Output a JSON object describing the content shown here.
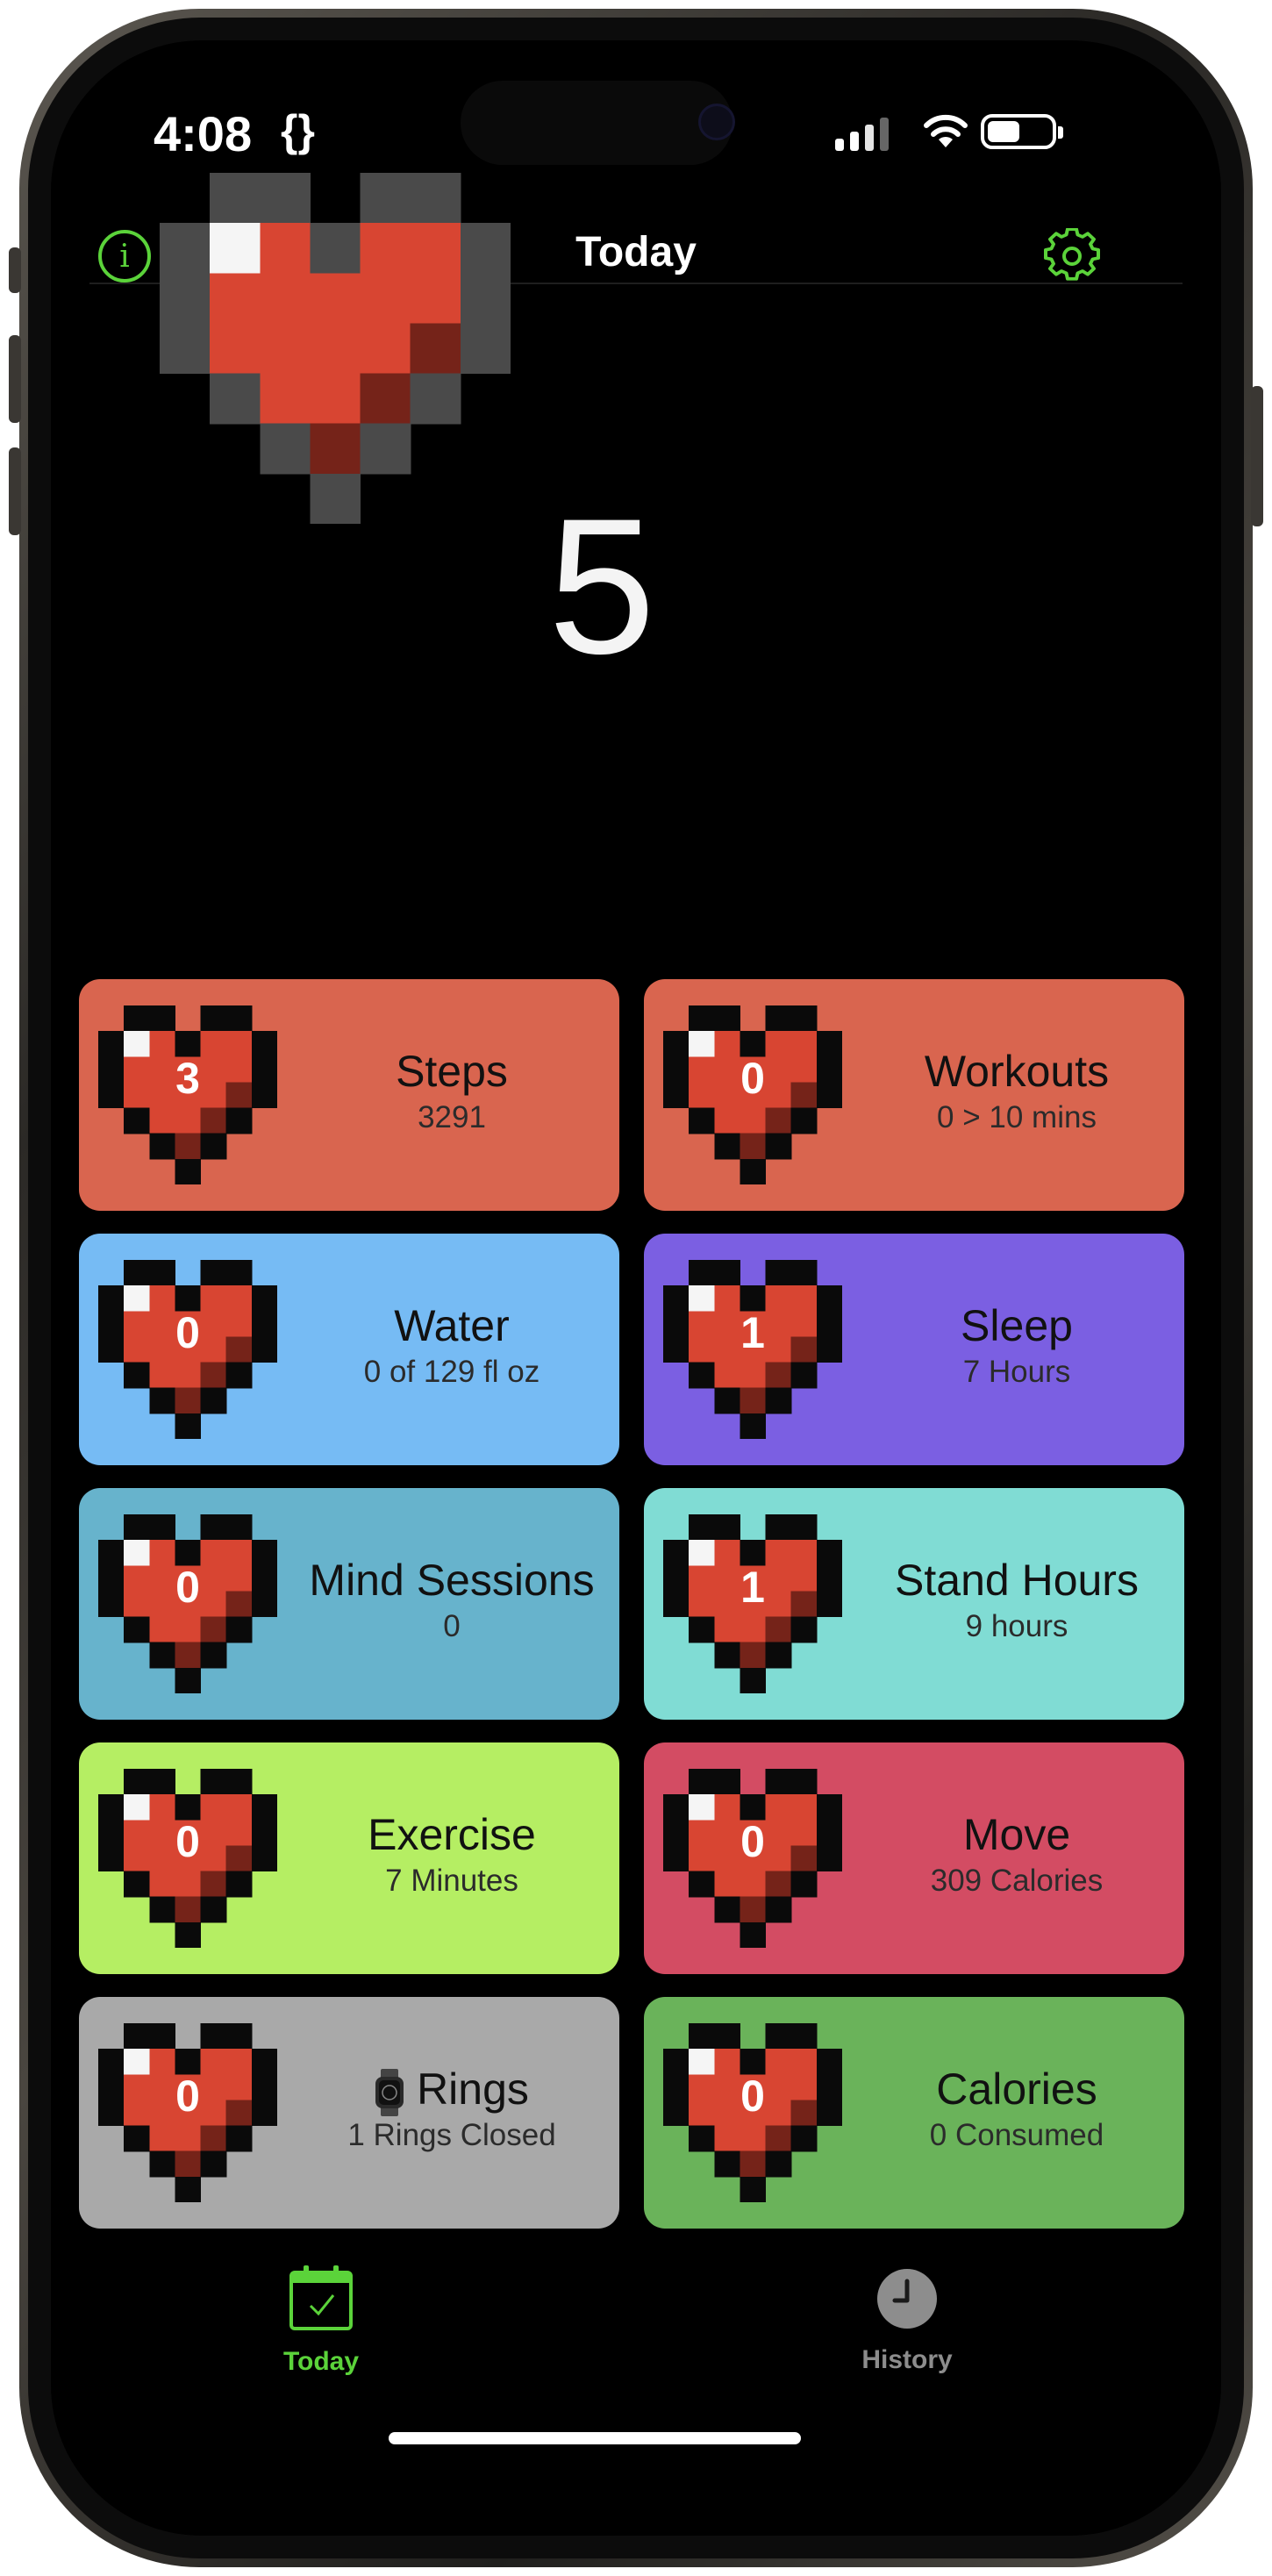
{
  "status_bar": {
    "time": "4:08",
    "extra_symbol": "{}"
  },
  "nav": {
    "title": "Today",
    "info_icon": "info-icon",
    "settings_icon": "gear-icon"
  },
  "overall": {
    "score": "5"
  },
  "cards": [
    {
      "id": "steps",
      "label": "Steps",
      "sub": "3291",
      "score": "3",
      "color": "#d9654f"
    },
    {
      "id": "workouts",
      "label": "Workouts",
      "sub": "0 > 10 mins",
      "score": "0",
      "color": "#d9654f"
    },
    {
      "id": "water",
      "label": "Water",
      "sub": "0 of 129 fl oz",
      "score": "0",
      "color": "#76bbf4"
    },
    {
      "id": "sleep",
      "label": "Sleep",
      "sub": "7 Hours",
      "score": "1",
      "color": "#7b5fe2"
    },
    {
      "id": "mind",
      "label": "Mind Sessions",
      "sub": "0",
      "score": "0",
      "color": "#67b3cc"
    },
    {
      "id": "stand",
      "label": "Stand Hours",
      "sub": "9 hours",
      "score": "1",
      "color": "#80dcd4"
    },
    {
      "id": "exercise",
      "label": "Exercise",
      "sub": "7 Minutes",
      "score": "0",
      "color": "#b5ee63"
    },
    {
      "id": "move",
      "label": "Move",
      "sub": "309 Calories",
      "score": "0",
      "color": "#d34c63"
    },
    {
      "id": "rings",
      "label": "Rings",
      "sub": "1 Rings Closed",
      "score": "0",
      "color": "#a9a9a9",
      "icon": "watch-icon"
    },
    {
      "id": "calories",
      "label": "Calories",
      "sub": "0 Consumed",
      "score": "0",
      "color": "#6ab35a"
    }
  ],
  "tabs": [
    {
      "label": "Today",
      "icon": "calendar-check-icon",
      "active": true
    },
    {
      "label": "History",
      "icon": "clock-icon",
      "active": false
    }
  ],
  "colors": {
    "accent": "#5bd33a",
    "heart_red": "#d84532",
    "heart_dark": "#752319",
    "heart_outline_big": "#4a4a4a"
  }
}
